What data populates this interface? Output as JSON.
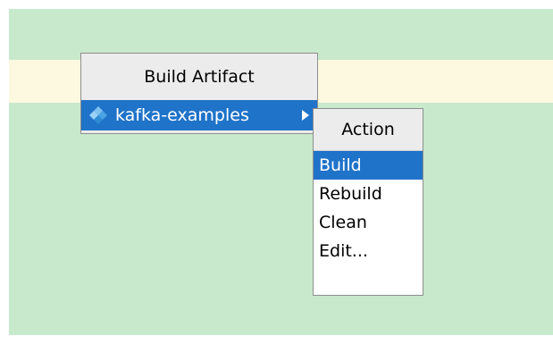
{
  "artifact_popup": {
    "title": "Build Artifact",
    "item": {
      "label": "kafka-examples",
      "icon": "artifact-icon"
    }
  },
  "action_popup": {
    "title": "Action",
    "items": [
      {
        "label": "Build",
        "selected": true
      },
      {
        "label": "Rebuild",
        "selected": false
      },
      {
        "label": "Clean",
        "selected": false
      },
      {
        "label": "Edit...",
        "selected": false
      }
    ]
  },
  "colors": {
    "editor_background": "#c8e9cb",
    "current_line": "#fdf8e0",
    "selection": "#1f73c9"
  }
}
